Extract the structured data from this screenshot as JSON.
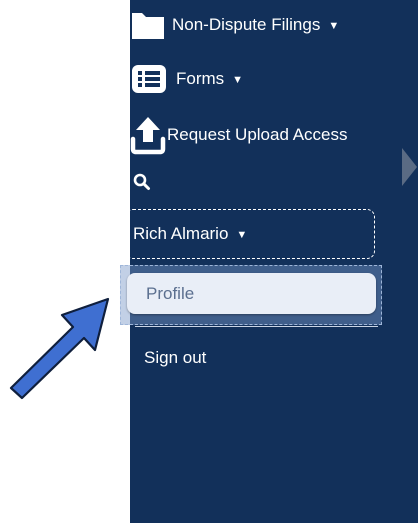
{
  "sidebar": {
    "items": [
      {
        "label": "Non-Dispute Filings",
        "icon": "folder-icon",
        "has_caret": true
      },
      {
        "label": "Forms",
        "icon": "list-icon",
        "has_caret": true
      },
      {
        "label": "Request Upload Access",
        "icon": "upload-icon",
        "has_caret": false
      },
      {
        "label": "",
        "icon": "search-icon",
        "has_caret": false
      }
    ],
    "caret_glyph": "▼"
  },
  "user_menu": {
    "name": "Rich Almario",
    "items": [
      {
        "label": "Profile"
      },
      {
        "label": "Sign out"
      }
    ]
  },
  "colors": {
    "sidebar_bg": "#12305a",
    "profile_bg": "#e9eef7",
    "profile_text": "#5b6f8f",
    "annotation_arrow": "#3f6fd1"
  },
  "annotation": {
    "icon": "pointer-arrow-icon"
  }
}
